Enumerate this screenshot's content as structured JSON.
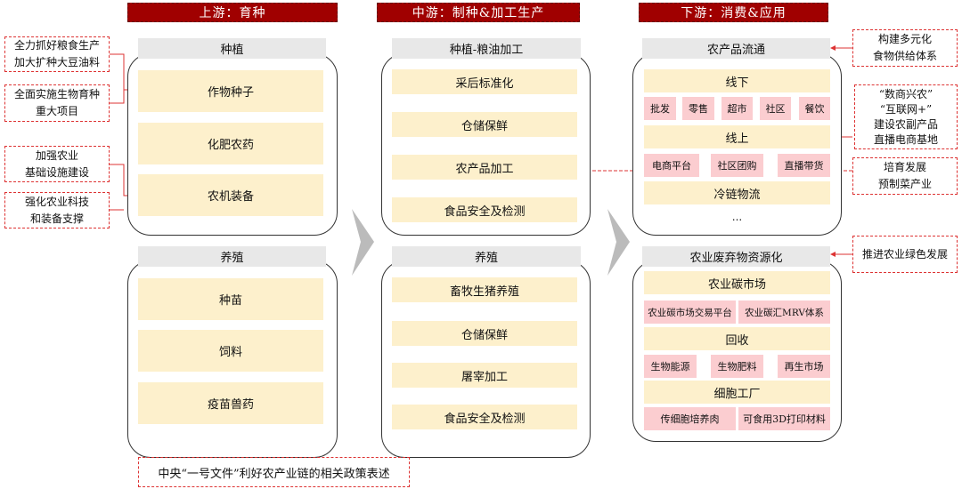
{
  "stages": {
    "upstream": "上游：育种",
    "midstream": "中游：制种&加工生产",
    "downstream": "下游：消费&应用"
  },
  "up": {
    "planting": {
      "title": "种植",
      "items": [
        "作物种子",
        "化肥农药",
        "农机装备"
      ]
    },
    "breeding": {
      "title": "养殖",
      "items": [
        "种苗",
        "饲料",
        "疫苗兽药"
      ]
    }
  },
  "mid": {
    "planting": {
      "title": "种植-粮油加工",
      "items": [
        "采后标准化",
        "仓储保鲜",
        "农产品加工",
        "食品安全及检测"
      ]
    },
    "breeding": {
      "title": "养殖",
      "items": [
        "畜牧生猪养殖",
        "仓储保鲜",
        "屠宰加工",
        "食品安全及检测"
      ]
    }
  },
  "down": {
    "circulation": {
      "title": "农产品流通",
      "offline": "线下",
      "offline_items": [
        "批发",
        "零售",
        "超市",
        "社区",
        "餐饮"
      ],
      "online": "线上",
      "online_items": [
        "电商平台",
        "社区团购",
        "直播带货"
      ],
      "cold": "冷链物流",
      "more": "..."
    },
    "waste": {
      "title": "农业废弃物资源化",
      "carbon": "农业碳市场",
      "carbon_items": [
        "农业碳市场交易平台",
        "农业碳汇MRV体系"
      ],
      "recycle": "回收",
      "recycle_items": [
        "生物能源",
        "生物肥料",
        "再生市场"
      ],
      "cell": "细胞工厂",
      "cell_items": [
        "传细胞培养肉",
        "可食用3D打印材料"
      ]
    }
  },
  "left_callouts": [
    [
      "全力抓好粮食生产",
      "加大扩种大豆油料"
    ],
    [
      "全面实施生物育种",
      "重大项目"
    ],
    [
      "加强农业",
      "基础设施建设"
    ],
    [
      "强化农业科技",
      "和装备支撑"
    ]
  ],
  "right_callouts": [
    [
      "构建多元化",
      "食物供给体系"
    ],
    [
      "“数商兴农”",
      "“互联网+”",
      "建设农副产品",
      "直播电商基地"
    ],
    [
      "培育发展",
      "预制菜产业"
    ],
    [
      "推进农业绿色发展"
    ]
  ],
  "note": "中央“一号文件”利好农产业链的相关政策表述",
  "colors": {
    "header": "#a00000",
    "item": "#fdf0cc",
    "sub_item": "#fbcdd0",
    "callout_border": "#dd3333"
  }
}
